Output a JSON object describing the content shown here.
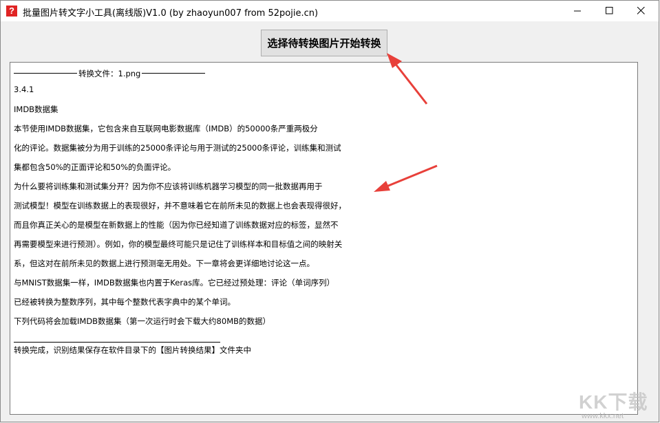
{
  "window": {
    "title": "批量图片转文字小工具(离线版)V1.0  (by zhaoyun007 from 52pojie.cn)",
    "app_icon_glyph": "?",
    "controls": [
      "minimize-icon",
      "maximize-icon",
      "close-icon"
    ]
  },
  "toolbar": {
    "convert_label": "选择待转换图片开始转换"
  },
  "output": {
    "header_label": "转换文件：1.png",
    "lines": [
      "3.4.1",
      "IMDB数据集",
      "本节使用IMDB数据集，它包含来自互联网电影数据库（IMDB）的50000条严重两极分",
      "化的评论。数据集被分为用于训练的25000条评论与用于测试的25000条评论，训练集和测试",
      "集都包含50%的正面评论和50%的负面评论。",
      "为什么要将训练集和测试集分开？因为你不应该将训练机器学习模型的同一批数据再用于",
      "测试模型！模型在训练数据上的表现很好，并不意味着它在前所未见的数据上也会表现得很好，",
      "而且你真正关心的是模型在新数据上的性能（因为你已经知道了训练数据对应的标签，显然不",
      "再需要模型来进行预测）。例如，你的模型最终可能只是记住了训练样本和目标值之间的映射关",
      "系，但这对在前所未见的数据上进行预测毫无用处。下一章将会更详细地讨论这一点。",
      "与MNIST数据集一样，IMDB数据集也内置于Keras库。它已经过预处理：评论（单词序列）",
      "已经被转换为整数序列，其中每个整数代表字典中的某个单词。",
      "下列代码将会加载IMDB数据集（第一次运行时会下载大约80MB的数据）"
    ],
    "footer_line": "转换完成，识别结果保存在软件目录下的【图片转换结果】文件夹中"
  },
  "annotations": {
    "arrow_color": "#e8403a"
  },
  "watermark": {
    "logo": "KK下载",
    "url": "www.kkx.net"
  }
}
